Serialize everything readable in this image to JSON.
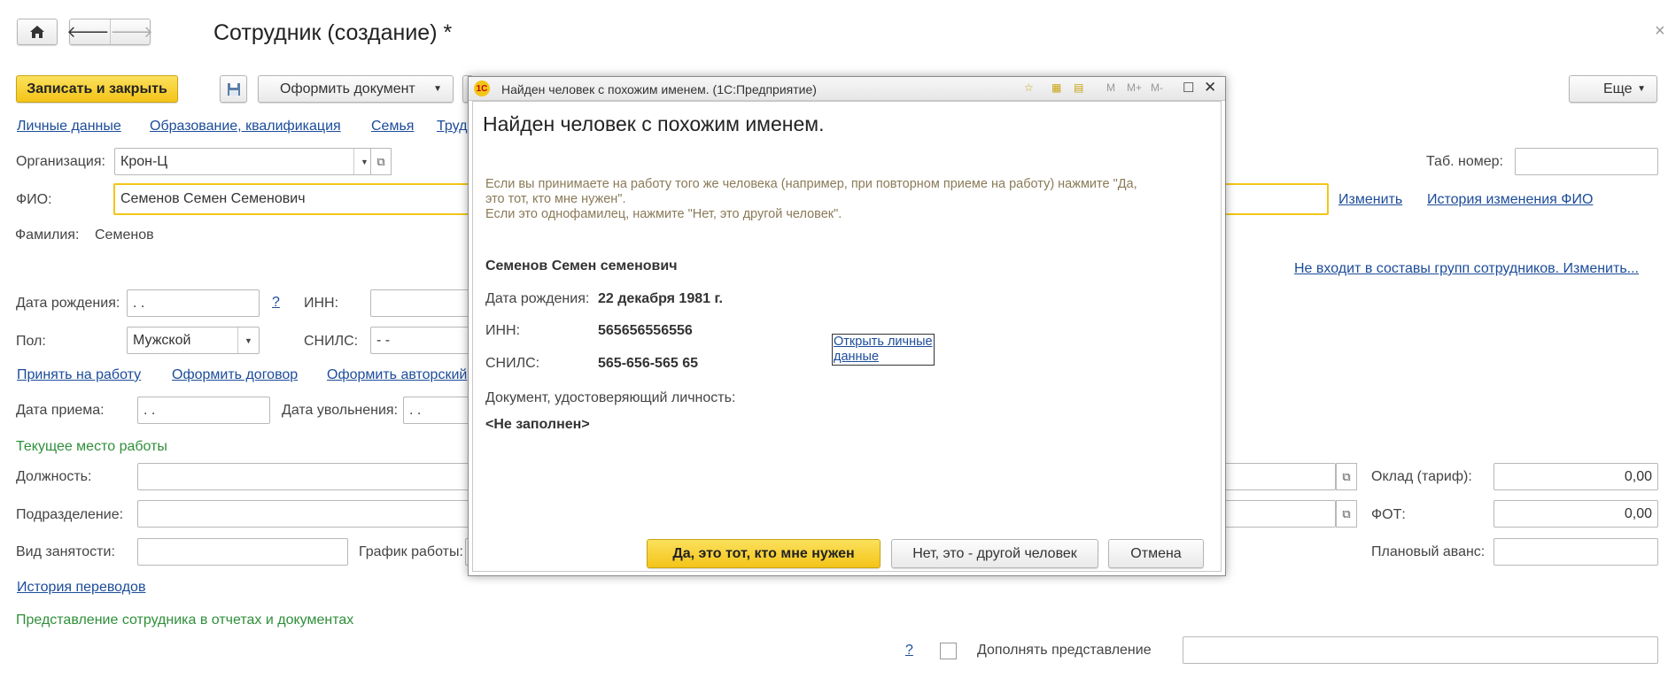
{
  "window": {
    "title": "Сотрудник (создание) *",
    "close_glyph": "×"
  },
  "toolbar": {
    "save_close_label": "Записать и закрыть",
    "make_document_label": "Оформить документ",
    "more_label": "Еще"
  },
  "nav_links": [
    "Личные данные",
    "Образование, квалификация",
    "Семья",
    "Трудо"
  ],
  "form": {
    "org_label": "Организация:",
    "org_value": "Крон-Ц",
    "tab_number_label": "Таб. номер:",
    "tab_number_value": "",
    "fio_label": "ФИО:",
    "fio_value": "Семенов Семен Семенович",
    "change_link": "Изменить",
    "fio_history_link": "История изменения ФИО",
    "surname_label": "Фамилия:",
    "surname_value": "Семенов",
    "groups_link": "Не входит в составы групп сотрудников. Изменить...",
    "birth_label": "Дата рождения:",
    "birth_value": ". .",
    "help_mark": "?",
    "inn_label": "ИНН:",
    "inn_value": "",
    "gender_label": "Пол:",
    "gender_value": "Мужской",
    "snils_label": "СНИЛС:",
    "snils_value": "-  -",
    "action_links": [
      "Принять на работу",
      "Оформить договор",
      "Оформить авторский"
    ],
    "hire_date_label": "Дата приема:",
    "hire_date_value": ". .",
    "dismiss_date_label": "Дата увольнения:",
    "dismiss_date_value": ". .",
    "current_job_section": "Текущее место работы",
    "position_label": "Должность:",
    "salary_label": "Оклад (тариф):",
    "salary_value": "0,00",
    "department_label": "Подразделение:",
    "fot_label": "ФОТ:",
    "fot_value": "0,00",
    "employment_label": "Вид занятости:",
    "schedule_label": "График работы:",
    "advance_label": "Плановый аванс:",
    "history_link": "История переводов",
    "representation_section": "Представление сотрудника в отчетах и документах",
    "complement_label": "Дополнять представление"
  },
  "dialog": {
    "title": "Найден человек с похожим именем. (1С:Предприятие)",
    "toolbar_icons": [
      "favorite-icon",
      "calculator-icon",
      "calendar-icon",
      "M",
      "M+",
      "M-"
    ],
    "heading": "Найден человек с похожим именем.",
    "message_lines": [
      "Если вы принимаете на работу того же человека (например, при повторном приеме на работу) нажмите \"Да,",
      "это тот, кто мне нужен\".",
      "Если это однофамилец, нажмите \"Нет, это другой человек\"."
    ],
    "person_name": "Семенов Семен семенович",
    "birth_label": "Дата рождения:",
    "birth_value": "22 декабря 1981 г.",
    "inn_label": "ИНН:",
    "inn_value": "565656556556",
    "snils_label": "СНИЛС:",
    "snils_value": "565-656-565 65",
    "open_personal_line1": "Открыть личные",
    "open_personal_line2": "данные",
    "doc_label": "Документ, удостоверяющий личность:",
    "doc_value": "<Не заполнен>",
    "yes_label": "Да, это тот, кто мне нужен",
    "no_label": "Нет, это - другой человек",
    "cancel_label": "Отмена"
  }
}
